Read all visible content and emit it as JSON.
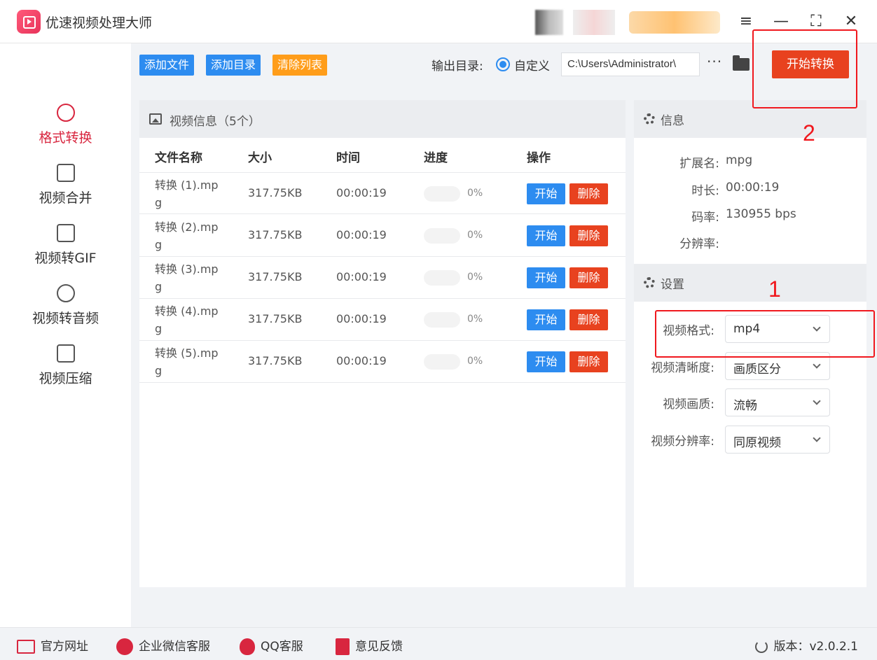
{
  "app": {
    "title": "优速视频处理大师"
  },
  "window": {
    "menu_icon": "≡",
    "min_icon": "—",
    "max_icon": "⛶",
    "close_icon": "✕"
  },
  "sidebar": {
    "items": [
      {
        "label": "格式转换",
        "icon": "convert-icon",
        "active": true
      },
      {
        "label": "视频合并",
        "icon": "merge-icon"
      },
      {
        "label": "视频转GIF",
        "icon": "gif-icon"
      },
      {
        "label": "视频转音频",
        "icon": "audio-icon"
      },
      {
        "label": "视频压缩",
        "icon": "compress-icon"
      }
    ]
  },
  "toolbar": {
    "add_file": "添加文件",
    "add_dir": "添加目录",
    "clear_list": "清除列表",
    "output_label": "输出目录:",
    "radio_label": "自定义",
    "output_path": "C:\\Users\\Administrator\\",
    "more": "···",
    "start_convert": "开始转换"
  },
  "video_panel": {
    "title": "视频信息（5个）",
    "columns": [
      "文件名称",
      "大小",
      "时间",
      "进度",
      "操作"
    ],
    "rows": [
      {
        "name": "转换 (1).mpg",
        "size": "317.75KB",
        "time": "00:00:19",
        "progress": "0%",
        "start": "开始",
        "delete": "删除"
      },
      {
        "name": "转换 (2).mpg",
        "size": "317.75KB",
        "time": "00:00:19",
        "progress": "0%",
        "start": "开始",
        "delete": "删除"
      },
      {
        "name": "转换 (3).mpg",
        "size": "317.75KB",
        "time": "00:00:19",
        "progress": "0%",
        "start": "开始",
        "delete": "删除"
      },
      {
        "name": "转换 (4).mpg",
        "size": "317.75KB",
        "time": "00:00:19",
        "progress": "0%",
        "start": "开始",
        "delete": "删除"
      },
      {
        "name": "转换 (5).mpg",
        "size": "317.75KB",
        "time": "00:00:19",
        "progress": "0%",
        "start": "开始",
        "delete": "删除"
      }
    ]
  },
  "info_panel": {
    "title": "信息",
    "ext_label": "扩展名:",
    "ext_value": "mpg",
    "duration_label": "时长:",
    "duration_value": "00:00:19",
    "bitrate_label": "码率:",
    "bitrate_value": "130955 bps",
    "resolution_label": "分辨率:"
  },
  "settings_panel": {
    "title": "设置",
    "format_label": "视频格式:",
    "format_value": "mp4",
    "clarity_label": "视频清晰度:",
    "clarity_value": "画质区分",
    "quality_label": "视频画质:",
    "quality_value": "流畅",
    "resolution_label": "视频分辨率:",
    "resolution_value": "同原视频"
  },
  "annotations": {
    "one": "1",
    "two": "2",
    "color": "#f0181e"
  },
  "footer": {
    "website": "官方网址",
    "wechat": "企业微信客服",
    "qq": "QQ客服",
    "feedback": "意见反馈",
    "version": "版本：v2.0.2.1"
  },
  "colors": {
    "accent_blue": "#2d8cf0",
    "accent_orange": "#ff9d1a",
    "accent_red": "#e8421f",
    "brand_red": "#d8263f"
  }
}
